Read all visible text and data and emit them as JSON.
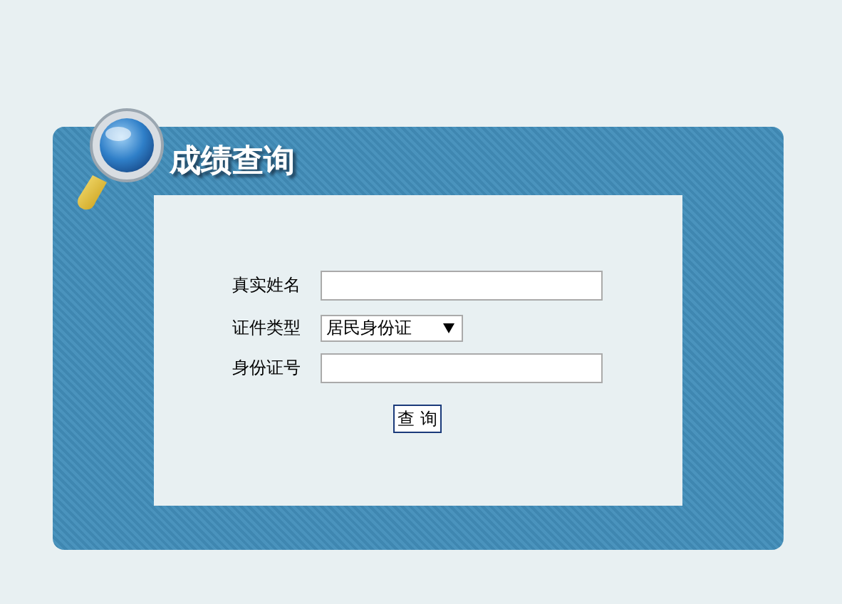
{
  "panel": {
    "title": "成绩查询"
  },
  "form": {
    "fields": [
      {
        "kind": "text",
        "label": "真实姓名"
      },
      {
        "kind": "select",
        "label": "证件类型",
        "value": "居民身份证"
      },
      {
        "kind": "text",
        "label": "身份证号"
      }
    ],
    "submit": "查 询"
  }
}
